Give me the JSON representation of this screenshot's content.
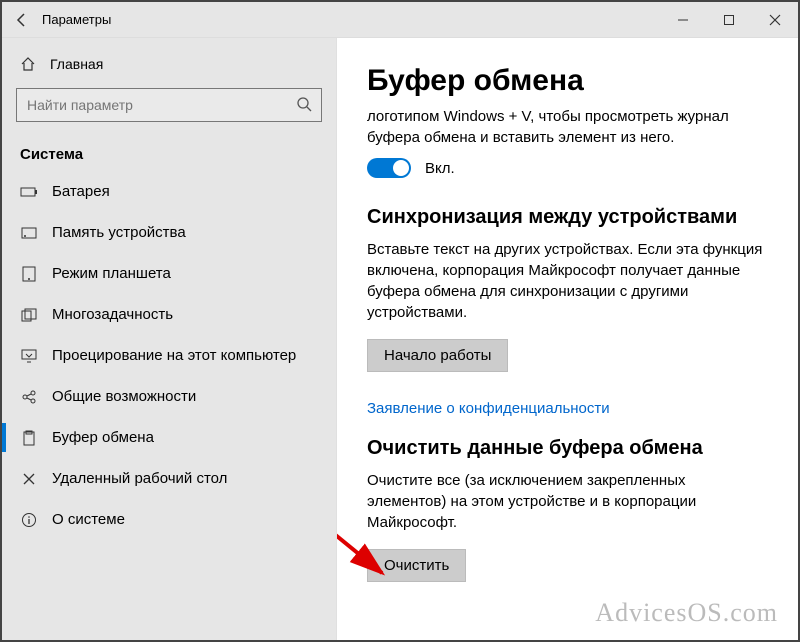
{
  "titlebar": {
    "title": "Параметры"
  },
  "sidebar": {
    "home_label": "Главная",
    "search_placeholder": "Найти параметр",
    "group_label": "Система",
    "items": [
      {
        "label": "Батарея"
      },
      {
        "label": "Память устройства"
      },
      {
        "label": "Режим планшета"
      },
      {
        "label": "Многозадачность"
      },
      {
        "label": "Проецирование на этот компьютер"
      },
      {
        "label": "Общие возможности"
      },
      {
        "label": "Буфер обмена"
      },
      {
        "label": "Удаленный рабочий стол"
      },
      {
        "label": "О системе"
      }
    ]
  },
  "content": {
    "title": "Буфер обмена",
    "history_desc": "логотипом Windows + V, чтобы просмотреть журнал буфера обмена и вставить элемент из него.",
    "toggle_label": "Вкл.",
    "sync_title": "Синхронизация между устройствами",
    "sync_desc": "Вставьте текст на других устройствах. Если эта функция включена, корпорация Майкрософт получает данные буфера обмена для синхронизации с другими устройствами.",
    "sync_button": "Начало работы",
    "privacy_link": "Заявление о конфиденциальности",
    "clear_title": "Очистить данные буфера обмена",
    "clear_desc": "Очистите все (за исключением закрепленных элементов) на этом устройстве и в корпорации Майкрософт.",
    "clear_button": "Очистить"
  },
  "watermark": "AdvicesOS.com"
}
